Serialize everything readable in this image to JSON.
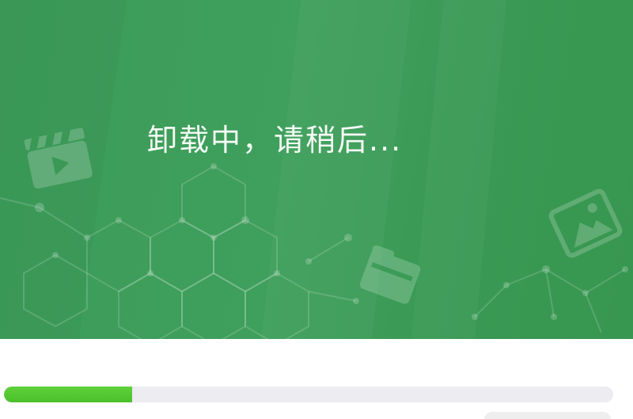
{
  "window": {
    "status_text": "卸载中，请稍后...",
    "progress_fraction": 0.21
  },
  "colors": {
    "banner_green": "#3c9b58",
    "progress_green": "#52c530",
    "track_gray": "#ececf1",
    "text_white": "#f4fbf5"
  },
  "icons": [
    "video-clapper-icon",
    "image-icon",
    "folder-icon",
    "molecule-network-icon"
  ]
}
